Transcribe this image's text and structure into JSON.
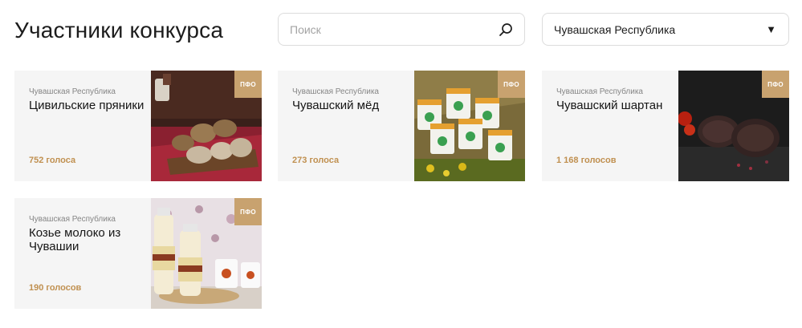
{
  "header": {
    "title": "Участники конкурса",
    "search": {
      "placeholder": "Поиск",
      "value": ""
    },
    "region_select": {
      "value": "Чувашская Республика"
    }
  },
  "cards": [
    {
      "region": "Чувашская Республика",
      "name": "Цивильские пряники",
      "votes": "752 голоса",
      "badge": "ПФО",
      "photo_icon": "gingerbread-photo"
    },
    {
      "region": "Чувашская Республика",
      "name": "Чувашский мёд",
      "votes": "273 голоса",
      "badge": "ПФО",
      "photo_icon": "honey-jars-photo"
    },
    {
      "region": "Чувашская Республика",
      "name": "Чувашский шартан",
      "votes": "1 168 голосов",
      "badge": "ПФО",
      "photo_icon": "shartan-photo"
    },
    {
      "region": "Чувашская Республика",
      "name": "Козье молоко из Чувашии",
      "votes": "190 голосов",
      "badge": "ПФО",
      "photo_icon": "goat-milk-photo"
    }
  ],
  "colors": {
    "card_bg": "#f5f5f5",
    "badge": "#c8a26f",
    "votes": "#c09050"
  }
}
